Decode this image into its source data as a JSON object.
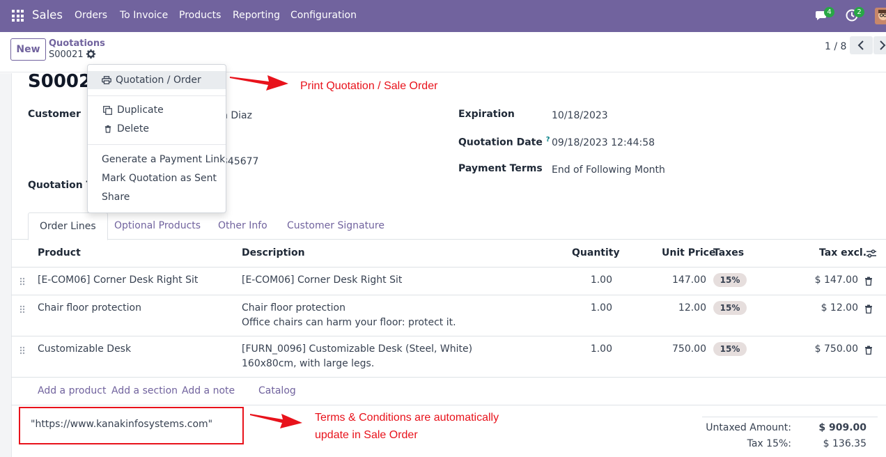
{
  "navbar": {
    "app_name": "Sales",
    "menu": [
      "Orders",
      "To Invoice",
      "Products",
      "Reporting",
      "Configuration"
    ],
    "messages_badge": "4",
    "activities_badge": "2",
    "icons": [
      "apps-grid-icon",
      "chat-icon",
      "clock-icon",
      "avatar"
    ]
  },
  "control_panel": {
    "new_label": "New",
    "breadcrumb_parent": "Quotations",
    "breadcrumb_current": "S00021",
    "pager": "1 / 8"
  },
  "record": {
    "title": "S00021",
    "customer_label": "Customer",
    "customer_value_partial": "n Diaz",
    "customer_phone_partial": "345677",
    "quotation_template_label": "Quotation Te",
    "expiration_label": "Expiration",
    "expiration_value": "10/18/2023",
    "quotation_date_label": "Quotation Date",
    "quotation_date_help": "?",
    "quotation_date_value": "09/18/2023 12:44:58",
    "payment_terms_label": "Payment Terms",
    "payment_terms_value": "End of Following Month"
  },
  "action_menu": {
    "print_item": "Quotation / Order",
    "duplicate": "Duplicate",
    "delete": "Delete",
    "payment_link": "Generate a Payment Link",
    "mark_sent": "Mark Quotation as Sent",
    "share": "Share"
  },
  "tabs": [
    "Order Lines",
    "Optional Products",
    "Other Info",
    "Customer Signature"
  ],
  "table": {
    "columns": [
      "Product",
      "Description",
      "Quantity",
      "Unit Price",
      "Taxes",
      "Tax excl."
    ],
    "rows": [
      {
        "product": "[E-COM06] Corner Desk Right Sit",
        "desc1": "[E-COM06] Corner Desk Right Sit",
        "desc2": "",
        "qty": "1.00",
        "price": "147.00",
        "tax": "15%",
        "subtotal": "$ 147.00"
      },
      {
        "product": "Chair floor protection",
        "desc1": "Chair floor protection",
        "desc2": "Office chairs can harm your floor: protect it.",
        "qty": "1.00",
        "price": "12.00",
        "tax": "15%",
        "subtotal": "$ 12.00"
      },
      {
        "product": "Customizable Desk",
        "desc1": "[FURN_0096] Customizable Desk (Steel, White)",
        "desc2": "160x80cm, with large legs.",
        "qty": "1.00",
        "price": "750.00",
        "tax": "15%",
        "subtotal": "$ 750.00"
      }
    ],
    "add_links": [
      "Add a product",
      "Add a section",
      "Add a note",
      "Catalog"
    ]
  },
  "terms": "\"https://www.kanakinfosystems.com\"",
  "totals": {
    "untaxed_label": "Untaxed Amount:",
    "untaxed_value": "$ 909.00",
    "tax_label": "Tax 15%:",
    "tax_value": "$ 136.35"
  },
  "annotations": {
    "print_note": "Print Quotation / Sale Order",
    "terms_note_line1": "Terms & Conditions are automatically",
    "terms_note_line2": "update in Sale Order",
    "color": "#e8121b"
  },
  "colors": {
    "brand": "#71639e",
    "badge": "#28a745"
  }
}
